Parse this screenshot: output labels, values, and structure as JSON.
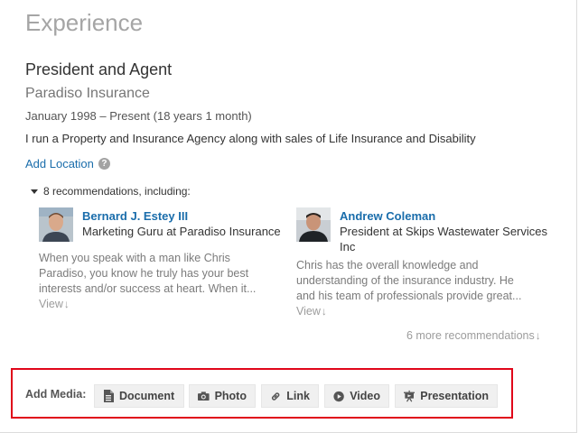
{
  "section": {
    "title": "Experience"
  },
  "position": {
    "title": "President and Agent",
    "company": "Paradiso Insurance",
    "dates": "January 1998 – Present (18 years 1 month)",
    "description": "I run a Property and Insurance Agency along with sales of Life Insurance and Disability",
    "add_location": "Add Location",
    "help_icon_glyph": "?"
  },
  "recommendations": {
    "header": "8 recommendations, including:",
    "items": [
      {
        "name": "Bernard J. Estey III",
        "role": "Marketing Guru at Paradiso Insurance",
        "text": "When you speak with a man like Chris Paradiso, you know he truly has your best interests and/or success at heart. When it...",
        "view_label": "View",
        "view_arrow": "↓",
        "avatar_icon": "person-avatar"
      },
      {
        "name": "Andrew Coleman",
        "role": "President at Skips Wastewater Services Inc",
        "text": "Chris has the overall knowledge and understanding of the insurance industry. He and his team of professionals provide great...",
        "view_label": "View",
        "view_arrow": "↓",
        "avatar_icon": "person-avatar"
      }
    ],
    "more_label": "6 more recommendations",
    "more_arrow": "↓"
  },
  "media": {
    "label": "Add Media:",
    "buttons": [
      {
        "label": "Document",
        "icon": "document-icon"
      },
      {
        "label": "Photo",
        "icon": "camera-icon"
      },
      {
        "label": "Link",
        "icon": "link-icon"
      },
      {
        "label": "Video",
        "icon": "play-icon"
      },
      {
        "label": "Presentation",
        "icon": "presentation-icon"
      }
    ]
  },
  "colors": {
    "link": "#1a6dab",
    "highlight_border": "#e0061a",
    "muted_text": "#a5a5a5"
  }
}
